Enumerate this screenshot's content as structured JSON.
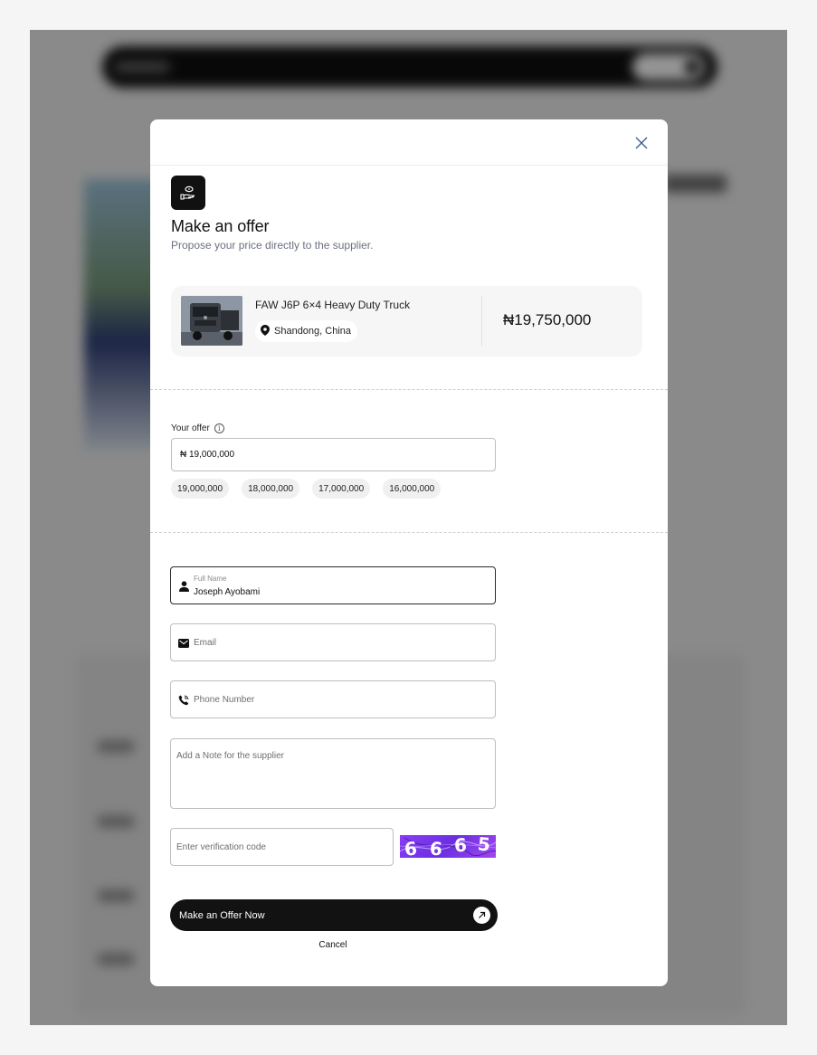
{
  "modal": {
    "title": "Make an offer",
    "subtitle": "Propose your price directly to the supplier."
  },
  "product": {
    "name": "FAW J6P 6×4 Heavy Duty Truck",
    "location": "Shandong, China",
    "price": "₦19,750,000"
  },
  "offer": {
    "label": "Your offer",
    "value": "₦ 19,000,000",
    "suggestions": [
      "19,000,000",
      "18,000,000",
      "17,000,000",
      "16,000,000"
    ]
  },
  "form": {
    "full_name_label": "Full Name",
    "full_name_value": "Joseph Ayobami",
    "email_placeholder": "Email",
    "phone_placeholder": "Phone Number",
    "note_placeholder": "Add a Note for the supplier",
    "verification_placeholder": "Enter verification code",
    "captcha_text": [
      "6",
      "6",
      "6",
      "5"
    ]
  },
  "actions": {
    "submit_label": "Make an Offer Now",
    "cancel_label": "Cancel"
  },
  "colors": {
    "primary": "#121212",
    "captcha": "#8a3df5",
    "muted_text": "#6b6f80"
  }
}
